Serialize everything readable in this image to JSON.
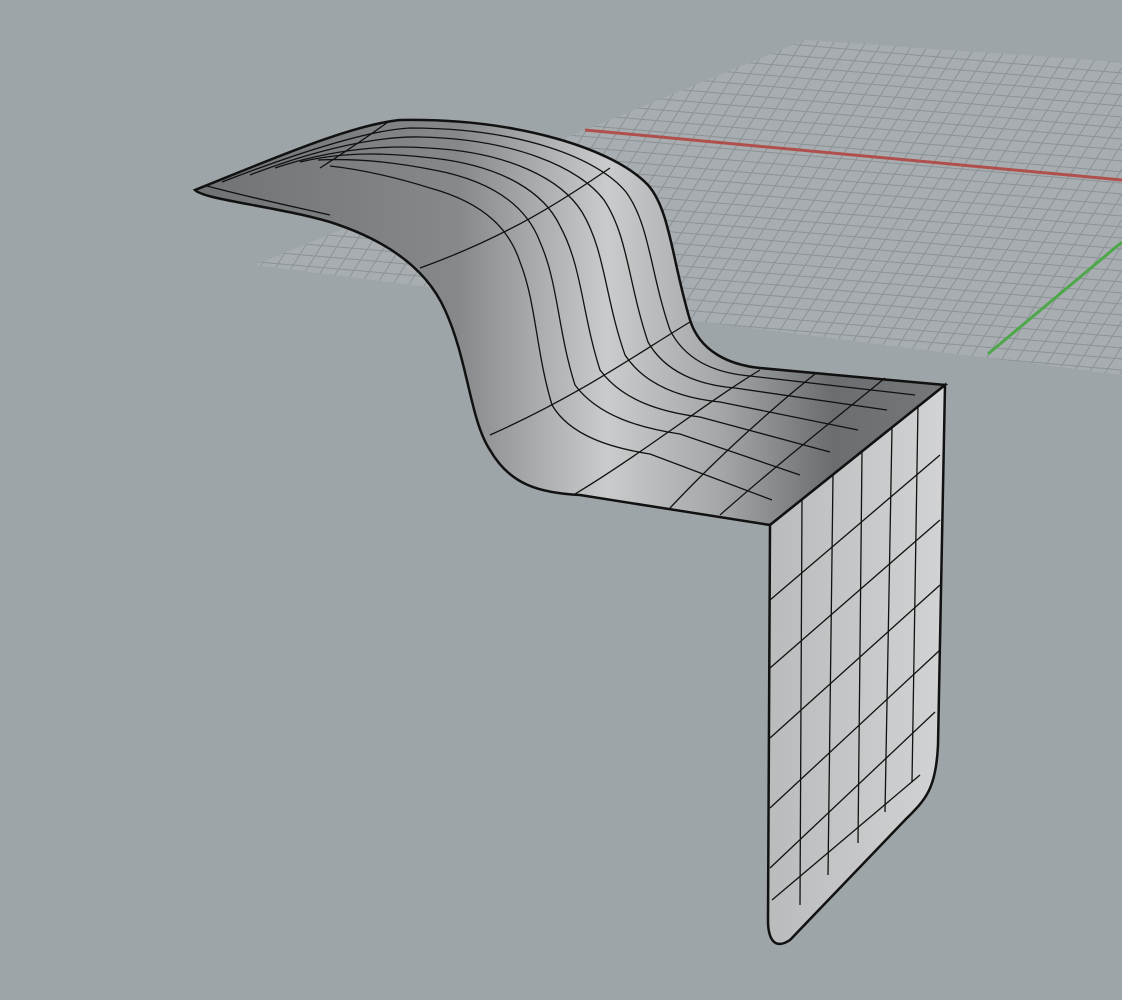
{
  "viewport": {
    "view": "perspective",
    "display_mode": "shaded",
    "colors": {
      "background": "#9ea5a8",
      "grid_fill": "#a7adb0",
      "grid_line": "#8c9396",
      "x_axis": "#b0504d",
      "y_axis": "#4ea84a",
      "surface_dark": "#6c7072",
      "surface_light": "#c6c8c9",
      "isocurve": "#111111"
    },
    "objects": [
      {
        "type": "surface",
        "shape": "s-curve-and-bend",
        "isocurves_u": 6,
        "isocurves_v": 6
      }
    ]
  }
}
